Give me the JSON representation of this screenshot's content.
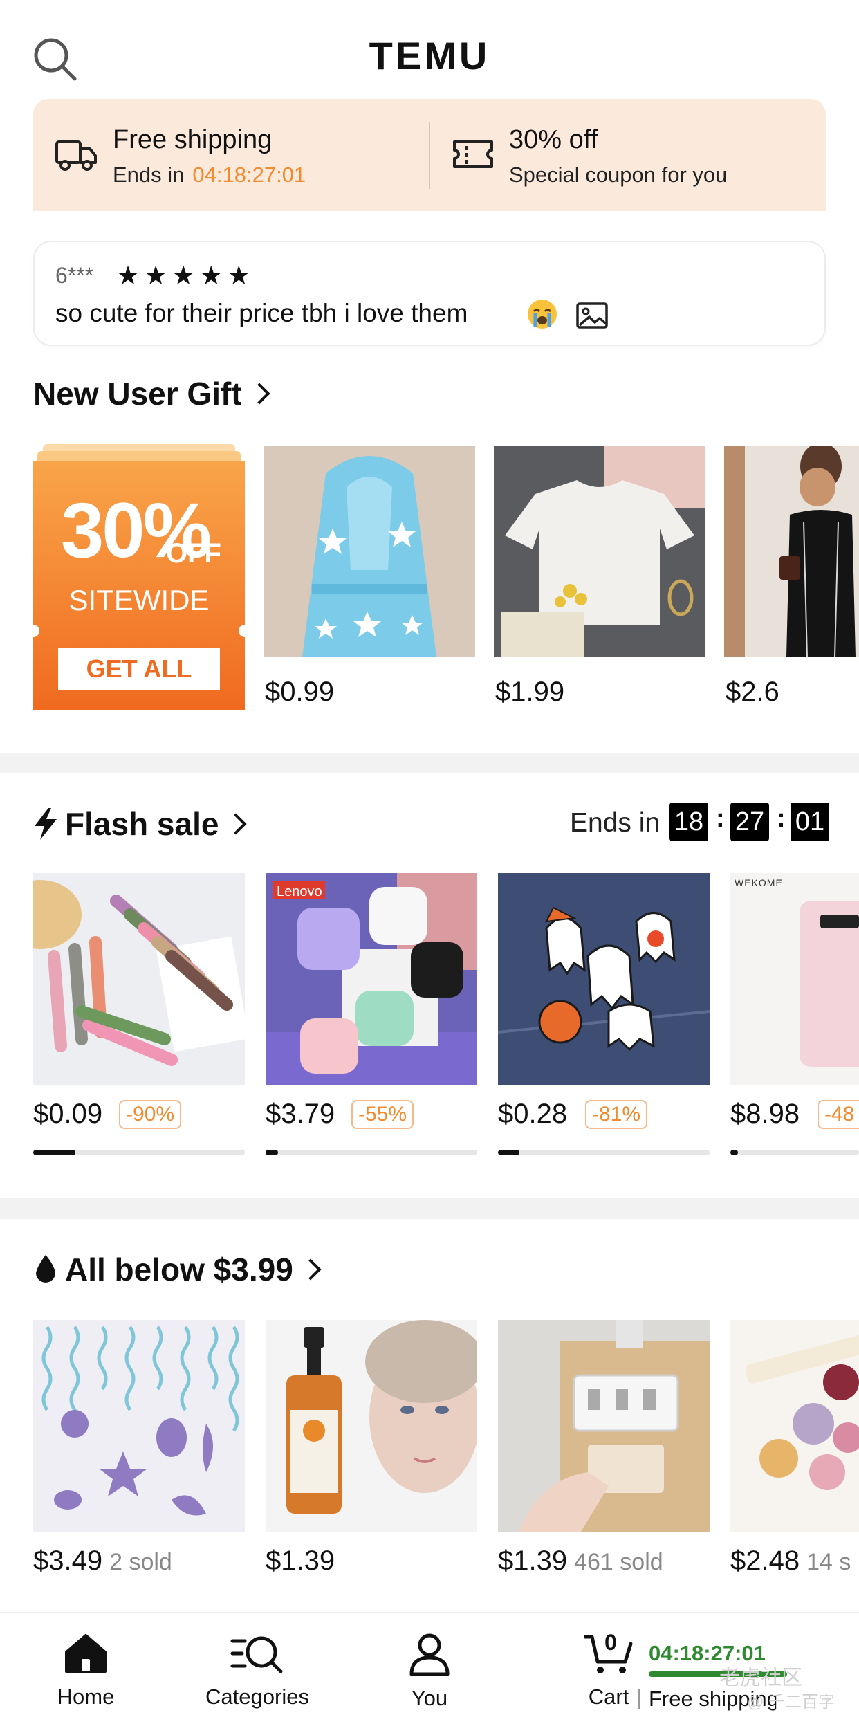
{
  "header": {
    "logo": "TEMU"
  },
  "promo": {
    "left_title": "Free shipping",
    "left_sub": "Ends in",
    "left_timer": "04:18:27:01",
    "right_title": "30% off",
    "right_sub": "Special coupon for you"
  },
  "review": {
    "reviewer": "6***",
    "stars": "★★★★★",
    "text": "so cute for their price tbh i love them",
    "rating": 5
  },
  "new_user_gift": {
    "title": "New User Gift",
    "card": {
      "big": "30%",
      "off": "OFF",
      "sitewide": "SITEWIDE",
      "button": "GET ALL"
    },
    "products": [
      {
        "price": "$0.99"
      },
      {
        "price": "$1.99"
      },
      {
        "price": "$2.6"
      }
    ]
  },
  "flash_sale": {
    "title": "Flash sale",
    "ends_label": "Ends in",
    "timer": {
      "h": "18",
      "m": "27",
      "s": "01"
    },
    "products": [
      {
        "price": "$0.09",
        "discount": "-90%",
        "progress": 0.2
      },
      {
        "price": "$3.79",
        "discount": "-55%",
        "progress": 0.06
      },
      {
        "price": "$0.28",
        "discount": "-81%",
        "progress": 0.1
      },
      {
        "price": "$8.98",
        "discount": "-48",
        "progress": 0.06
      }
    ],
    "brand_labels": {
      "lenovo": "Lenovo",
      "wekome": "WEKOME"
    }
  },
  "all_below": {
    "title": "All below $3.99",
    "products": [
      {
        "price": "$3.49",
        "sold": "2 sold"
      },
      {
        "price": "$1.39",
        "sold": ""
      },
      {
        "price": "$1.39",
        "sold": "461 sold"
      },
      {
        "price": "$2.48",
        "sold": "14 s"
      }
    ]
  },
  "nav": {
    "home": "Home",
    "categories": "Categories",
    "you": "You",
    "cart": "Cart",
    "cart_count": "0",
    "timer": "04:18:27:01",
    "free_shipping": "Free shipping"
  },
  "watermark": {
    "main": "老虎社区",
    "sub": "@ 千二百字"
  },
  "colors": {
    "accent_orange": "#f28a2e",
    "promo_bg": "#fbe9dc",
    "nav_green": "#2f8a2f"
  }
}
